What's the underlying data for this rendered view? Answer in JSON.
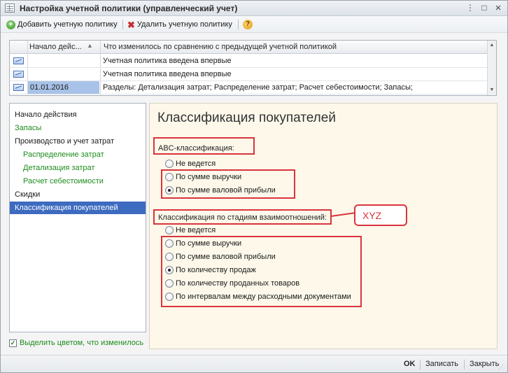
{
  "window": {
    "title": "Настройка учетной политики (управленческий учет)",
    "menu_symbol": "⋮",
    "restore_symbol": "□",
    "close_symbol": "×"
  },
  "toolbar": {
    "add_label": "Добавить учетную политику",
    "delete_label": "Удалить учетную политику",
    "help_symbol": "?"
  },
  "grid": {
    "columns": [
      "Начало дейс...",
      "Что изменилось по сравнению с предыдущей учетной политикой"
    ],
    "rows": [
      {
        "date": "",
        "change": "Учетная политика введена впервые"
      },
      {
        "date": "",
        "change": "Учетная политика введена впервые"
      },
      {
        "date": "01.01.2016",
        "change": "Разделы: Детализация затрат; Распределение затрат; Расчет себестоимости; Запасы;"
      }
    ]
  },
  "nav": {
    "items": [
      {
        "label": "Начало действия"
      },
      {
        "label": "Запасы"
      },
      {
        "label": "Производство и учет затрат"
      },
      {
        "label": "Распределение затрат"
      },
      {
        "label": "Детализация затрат"
      },
      {
        "label": "Расчет себестоимости"
      },
      {
        "label": "Скидки"
      },
      {
        "label": "Классификация покупателей"
      }
    ],
    "highlight_label": "Выделить цветом, что изменилось"
  },
  "panel": {
    "title": "Классификация покупателей",
    "abc": {
      "label": "ABC-классификация:",
      "options": [
        "Не ведется",
        "По сумме выручки",
        "По сумме валовой прибыли"
      ],
      "selected": 2
    },
    "xyz": {
      "label": "Классификация по стадиям взаимоотношений:",
      "options": [
        "Не ведется",
        "По сумме выручки",
        "По сумме валовой прибыли",
        "По количеству продаж",
        "По количеству проданных товаров",
        "По интервалам между расходными документами"
      ],
      "selected": 3
    },
    "callout": "XYZ"
  },
  "footer": {
    "ok_label": "OK",
    "save_label": "Записать",
    "close_label": "Закрыть"
  },
  "colors": {
    "accent_selected": "#3d6bbf",
    "changed_green": "#1c8c1c",
    "annotation_red": "#d9343d",
    "panel_bg": "#fdf8ea"
  }
}
